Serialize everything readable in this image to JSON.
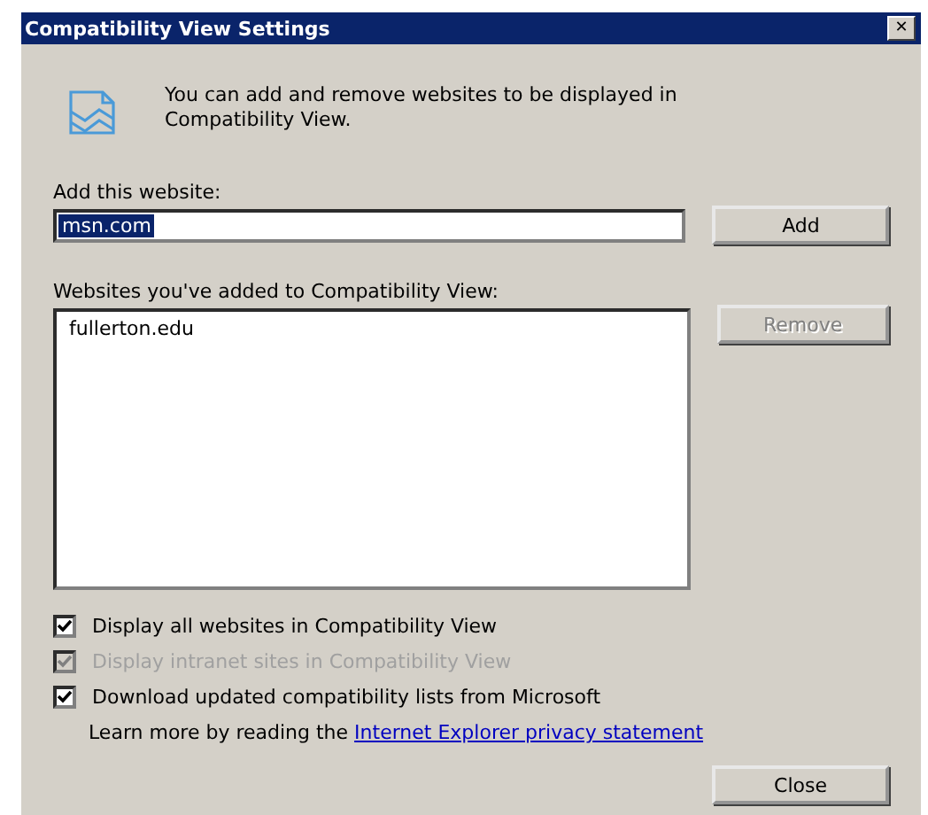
{
  "window": {
    "title": "Compatibility View Settings",
    "close": "✕"
  },
  "intro": "You can add and remove websites to be displayed in Compatibility View.",
  "add_field": {
    "label": "Add this website:",
    "value": "msn.com",
    "selected": true
  },
  "add_button": {
    "label": "Add",
    "disabled": false
  },
  "list": {
    "label": "Websites you've added to Compatibility View:",
    "items": [
      {
        "text": "fullerton.edu",
        "selected": false
      }
    ]
  },
  "remove_button": {
    "label": "Remove",
    "disabled": true
  },
  "options": [
    {
      "label": "Display all websites in Compatibility View",
      "checked": true,
      "disabled": false
    },
    {
      "label": "Display intranet sites in Compatibility View",
      "checked": true,
      "disabled": true
    },
    {
      "label": "Download updated compatibility lists from Microsoft",
      "checked": true,
      "disabled": false
    }
  ],
  "learn_more": {
    "text": "Learn more by reading the",
    "link": "Internet Explorer privacy statement"
  },
  "close_button": {
    "label": "Close",
    "disabled": false
  }
}
